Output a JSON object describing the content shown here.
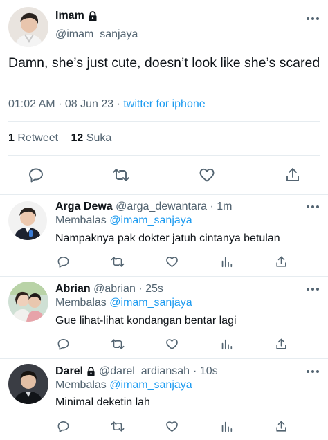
{
  "main_tweet": {
    "author_name": "Imam",
    "author_handle": "@imam_sanjaya",
    "text": "Damn, she’s just cute, doesn’t look like she’s scared",
    "time": "01:02 AM",
    "date": "08 Jun 23",
    "source": "twitter for iphone",
    "sep": "·",
    "retweet_count": "1",
    "retweet_label": "Retweet",
    "like_count": "12",
    "like_label": "Suka"
  },
  "replies": [
    {
      "name": "Arga Dewa",
      "handle": "@arga_dewantara",
      "time": "· 1m",
      "reply_prefix": "Membalas",
      "reply_to": "@imam_sanjaya",
      "text": "Nampaknya pak dokter jatuh cintanya betulan"
    },
    {
      "name": "Abrian",
      "handle": "@abrian",
      "time": "· 25s",
      "reply_prefix": "Membalas",
      "reply_to": "@imam_sanjaya",
      "text": "Gue lihat-lihat kondangan bentar lagi"
    },
    {
      "name": "Darel",
      "handle": "@darel_ardiansah",
      "time": "· 10s",
      "reply_prefix": "Membalas",
      "reply_to": "@imam_sanjaya",
      "text": "Minimal deketin lah"
    }
  ],
  "icons": {
    "reply": "reply-icon",
    "retweet": "retweet-icon",
    "like": "heart-icon",
    "share": "share-icon",
    "views": "views-icon",
    "lock": "lock-icon",
    "more": "more-icon"
  },
  "colors": {
    "accent": "#1d9bf0",
    "muted": "#536471",
    "text": "#0f1419",
    "divider": "#e6ecf0"
  }
}
